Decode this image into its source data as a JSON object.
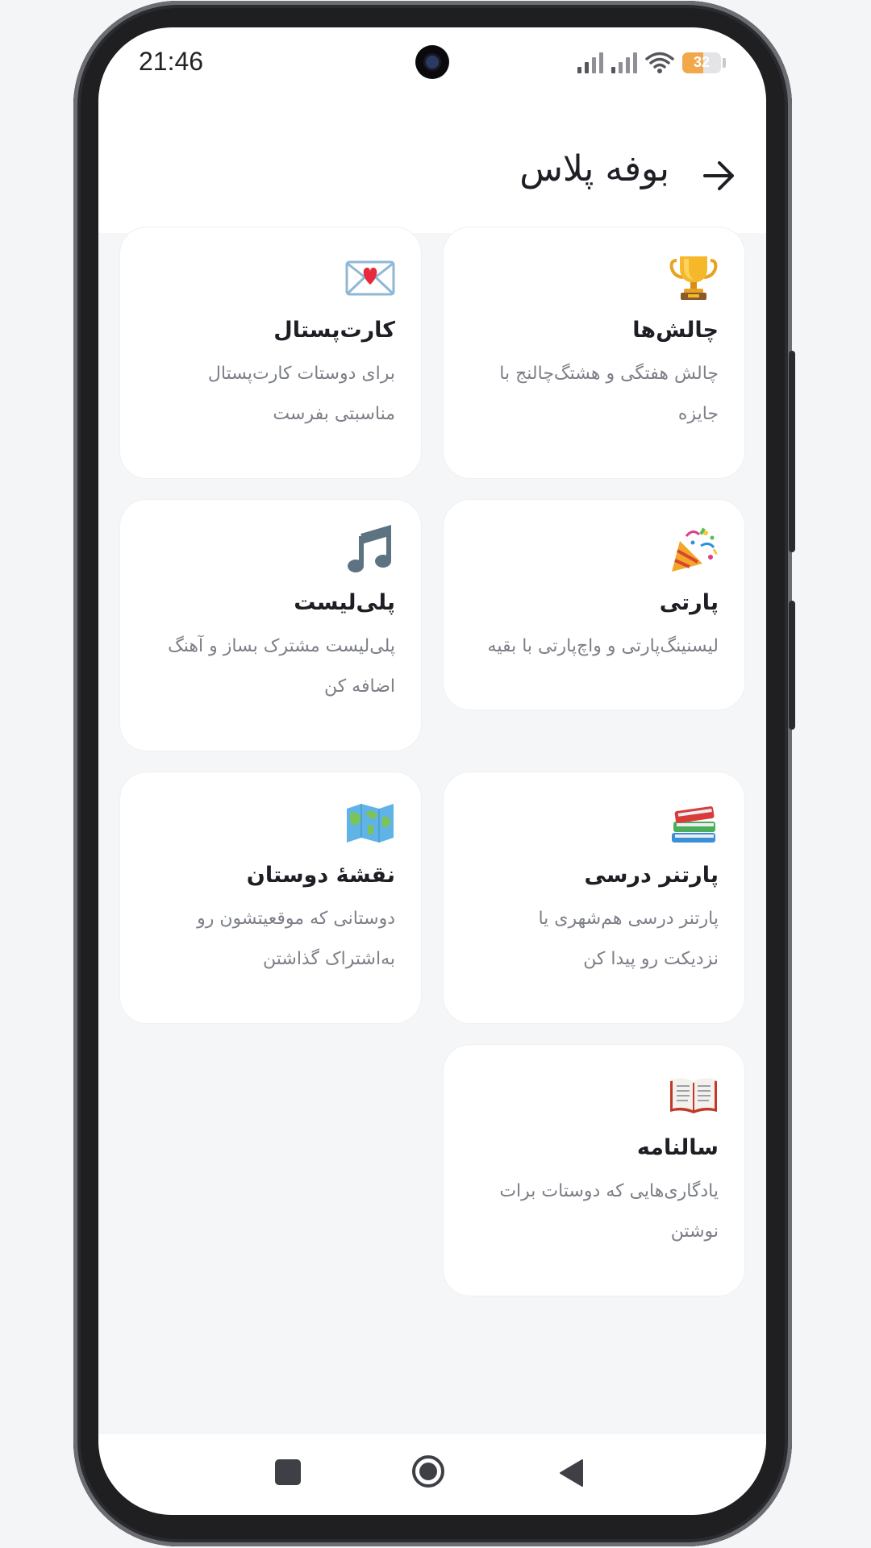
{
  "status_bar": {
    "time": "21:46",
    "battery_level": "32",
    "battery_fraction": 0.32,
    "icons": [
      "signal-icon",
      "signal-icon",
      "wifi-icon",
      "battery-icon"
    ]
  },
  "header": {
    "title": "بوفه پلاس",
    "back_icon": "arrow-right-icon"
  },
  "cards": [
    {
      "icon": "trophy-icon",
      "title": "چالش‌ها",
      "desc_line1": "چالش هفتگی و هشتگ‌چالنج با",
      "desc_line2": "جایزه"
    },
    {
      "icon": "love-letter-icon",
      "title": "کارت‌پستال",
      "desc_line1": "برای دوستات کارت‌پستال",
      "desc_line2": "مناسبتی بفرست"
    },
    {
      "icon": "party-popper-icon",
      "title": "پارتی",
      "desc_line1": "لیسنینگ‌پارتی و واچ‌پارتی با بقیه",
      "desc_line2": ""
    },
    {
      "icon": "music-note-icon",
      "title": "پلی‌لیست",
      "desc_line1": "پلی‌لیست مشترک بساز و آهنگ",
      "desc_line2": "اضافه کن"
    },
    {
      "icon": "books-icon",
      "title": "پارتنر درسی",
      "desc_line1": "پارتنر درسی هم‌شهری یا",
      "desc_line2": "نزدیکت رو پیدا کن"
    },
    {
      "icon": "world-map-icon",
      "title": "نقشهٔ دوستان",
      "desc_line1": "دوستانی که موقعیتشون رو",
      "desc_line2": "به‌اشتراک گذاشتن"
    },
    {
      "icon": "open-book-icon",
      "title": "سالنامه",
      "desc_line1": "یادگاری‌هایی که دوستات برات",
      "desc_line2": "نوشتن"
    }
  ],
  "nav_bar": {
    "icons": [
      "recent-apps-icon",
      "home-icon",
      "back-triangle-icon"
    ]
  },
  "colors": {
    "background": "#f5f6f8",
    "card": "#ffffff",
    "title_text": "#1d1f24",
    "desc_text": "#7c7f87",
    "battery": "#f2a84a"
  }
}
